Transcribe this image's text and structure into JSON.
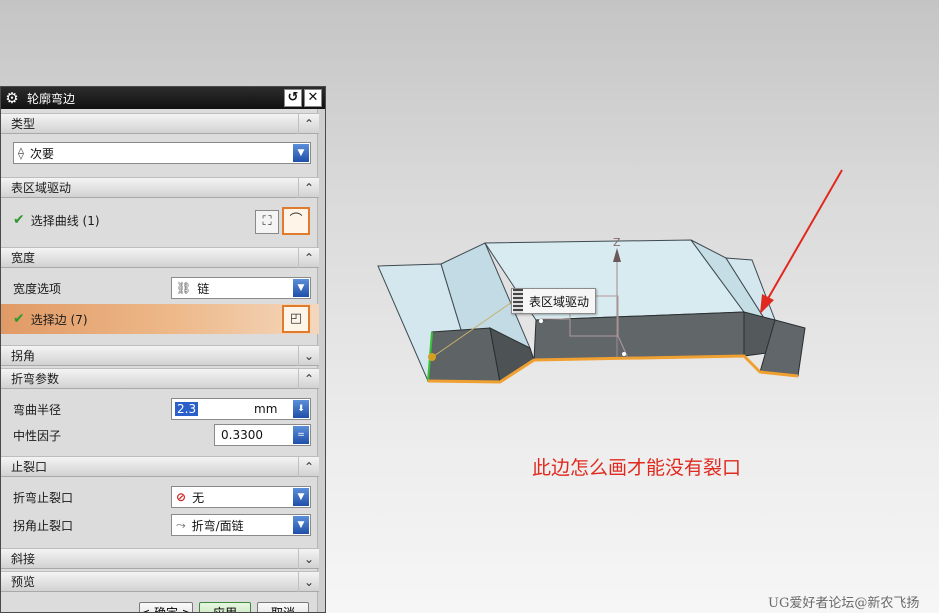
{
  "dialog": {
    "title": "轮廓弯边",
    "sections": {
      "type": {
        "label": "类型",
        "combo_value": "次要"
      },
      "surface_drive": {
        "label": "表区域驱动",
        "select_curve_label": "选择曲线 (1)"
      },
      "width": {
        "label": "宽度",
        "width_option_label": "宽度选项",
        "width_option_value": "链",
        "select_edge_label": "选择边 (7)"
      },
      "miter_corner": {
        "label": "拐角"
      },
      "bend_params": {
        "label": "折弯参数",
        "bend_radius_label": "弯曲半径",
        "bend_radius_value": "2.3",
        "bend_radius_unit": "mm",
        "neutral_factor_label": "中性因子",
        "neutral_factor_value": "0.3300"
      },
      "relief": {
        "label": "止裂口",
        "bend_relief_label": "折弯止裂口",
        "bend_relief_value": "无",
        "corner_relief_label": "拐角止裂口",
        "corner_relief_value": "折弯/面链"
      },
      "miter": {
        "label": "斜接"
      },
      "preview": {
        "label": "预览"
      }
    },
    "buttons": {
      "ok": "< 确定 >",
      "apply": "应用",
      "cancel": "取消"
    }
  },
  "viewport": {
    "tooltip_text": "表区域驱动",
    "axis_label": "Z",
    "annotation_text": "此边怎么画才能没有裂口",
    "watermark": "UG爱好者论坛@新农飞扬",
    "colors": {
      "annotation": "#e02a1f",
      "edge_highlight": "#f0a030",
      "face_blue": "#cfe3ea",
      "face_gray": "#5c6264"
    }
  }
}
